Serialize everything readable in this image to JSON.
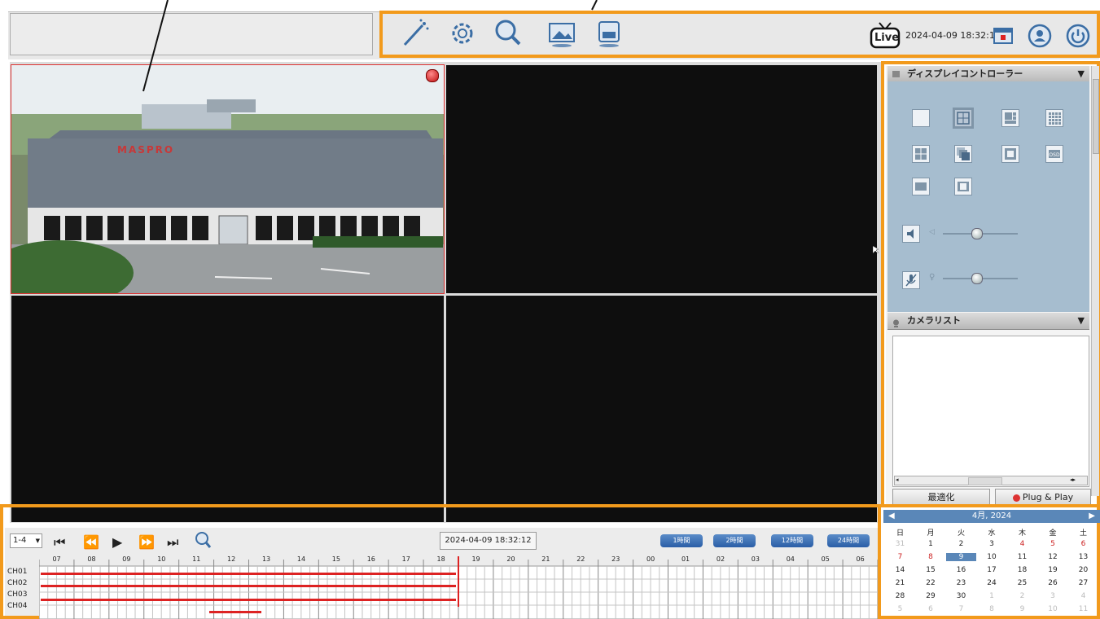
{
  "app": {
    "title_field": ""
  },
  "toolbar": {
    "tools": [
      {
        "name": "wizard-icon"
      },
      {
        "name": "settings-gear-icon"
      },
      {
        "name": "search-playback-icon"
      },
      {
        "name": "picture-icon"
      },
      {
        "name": "backup-icon"
      }
    ],
    "live_label": "Live",
    "datetime": "2024-04-09 18:32:12"
  },
  "video": {
    "selected_pane": 1,
    "pane1_sign": "MASPRO"
  },
  "right_panel": {
    "display_header": "ディスプレイコントローラー",
    "camera_header": "カメラリスト",
    "optimize_label": "最適化",
    "plugplay_label": "Plug & Play",
    "volume_level": 0.45,
    "mic_level": 0.45
  },
  "timeline": {
    "channel_select": "1-4",
    "date": "2024-04-09 18:32:12",
    "ranges": [
      "1時間",
      "2時間",
      "12時間",
      "24時間"
    ],
    "hours": [
      "07",
      "08",
      "09",
      "10",
      "11",
      "12",
      "13",
      "14",
      "15",
      "16",
      "17",
      "18",
      "19",
      "20",
      "21",
      "22",
      "23",
      "00",
      "01",
      "02",
      "03",
      "04",
      "05",
      "06"
    ],
    "channels": [
      "CH01",
      "CH02",
      "CH03",
      "CH04"
    ]
  },
  "calendar": {
    "title": "4月, 2024",
    "weekdays": [
      "日",
      "月",
      "火",
      "水",
      "木",
      "金",
      "土"
    ],
    "weeks": [
      [
        "31",
        "1",
        "2",
        "3",
        "4",
        "5",
        "6"
      ],
      [
        "7",
        "8",
        "9",
        "10",
        "11",
        "12",
        "13"
      ],
      [
        "14",
        "15",
        "16",
        "17",
        "18",
        "19",
        "20"
      ],
      [
        "21",
        "22",
        "23",
        "24",
        "25",
        "26",
        "27"
      ],
      [
        "28",
        "29",
        "30",
        "1",
        "2",
        "3",
        "4"
      ],
      [
        "5",
        "6",
        "7",
        "8",
        "9",
        "10",
        "11"
      ]
    ],
    "selected": "9"
  },
  "colors": {
    "accent": "#f29a1c",
    "record": "#dd2222",
    "calendar_header": "#5a87b8"
  }
}
